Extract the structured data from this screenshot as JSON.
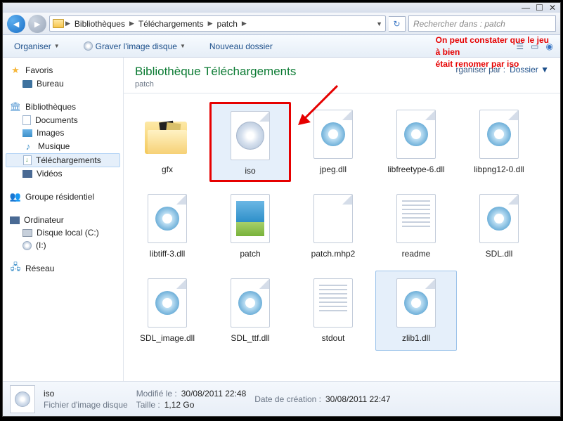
{
  "titlebar": {
    "min": "—",
    "max": "☐",
    "close": "✕"
  },
  "nav": {
    "crumbs": [
      "Bibliothèques",
      "Téléchargements",
      "patch"
    ],
    "search_placeholder": "Rechercher dans : patch"
  },
  "toolbar": {
    "organize": "Organiser",
    "burn": "Graver l'image disque",
    "newfolder": "Nouveau dossier"
  },
  "annotation": {
    "l1": "On peut constater que le jeu",
    "l2": "à bien",
    "l3": "était renomer par iso"
  },
  "sidebar": {
    "fav": "Favoris",
    "desk": "Bureau",
    "lib": "Bibliothèques",
    "docs": "Documents",
    "imgs": "Images",
    "mus": "Musique",
    "dl": "Téléchargements",
    "vid": "Vidéos",
    "grp": "Groupe résidentiel",
    "pc": "Ordinateur",
    "hdd": "Disque local (C:)",
    "cd": "(I:)",
    "net": "Réseau"
  },
  "header": {
    "title": "Bibliothèque Téléchargements",
    "sub": "patch",
    "org_lbl": "rganiser par :",
    "org_val": "Dossier"
  },
  "files": {
    "f0": "gfx",
    "f1": "iso",
    "f2": "jpeg.dll",
    "f3": "libfreetype-6.dll",
    "f4": "libpng12-0.dll",
    "f5": "libtiff-3.dll",
    "f6": "patch",
    "f7": "patch.mhp2",
    "f8": "readme",
    "f9": "SDL.dll",
    "f10": "SDL_image.dll",
    "f11": "SDL_ttf.dll",
    "f12": "stdout",
    "f13": "zlib1.dll"
  },
  "details": {
    "name": "iso",
    "type": "Fichier d'image disque",
    "mod_lbl": "Modifié le :",
    "mod_val": "30/08/2011 22:48",
    "size_lbl": "Taille :",
    "size_val": "1,12 Go",
    "created_lbl": "Date de création :",
    "created_val": "30/08/2011 22:47"
  }
}
